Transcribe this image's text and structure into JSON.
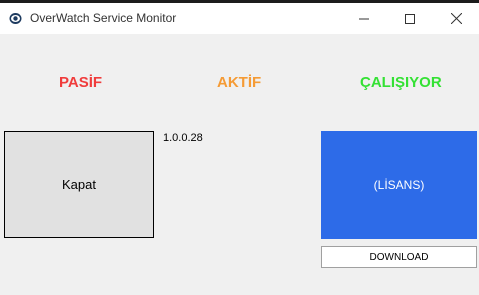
{
  "window": {
    "title": "OverWatch Service Monitor",
    "app_icon": "eye-icon",
    "controls": {
      "minimize_icon": "minimize-icon",
      "maximize_icon": "maximize-icon",
      "close_icon": "close-icon"
    }
  },
  "status": {
    "pasif": "PASİF",
    "aktif": "AKTİF",
    "calisiyor": "ÇALIŞIYOR"
  },
  "colors": {
    "pasif": "#f03c3c",
    "aktif": "#f59b35",
    "calisiyor": "#34e134",
    "license_button": "#2d6be8"
  },
  "buttons": {
    "kapat": "Kapat",
    "lisans": "(LİSANS)",
    "download": "DOWNLOAD"
  },
  "version": "1.0.0.28"
}
